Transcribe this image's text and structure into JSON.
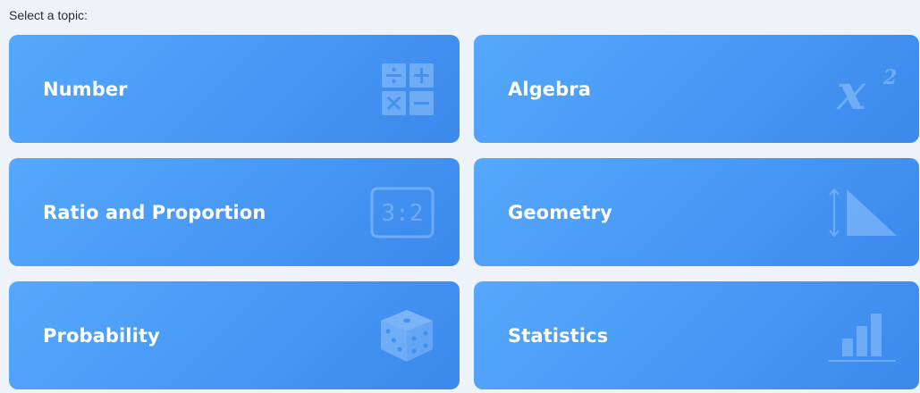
{
  "prompt": "Select a topic:",
  "topics": [
    {
      "label": "Number",
      "icon": "operations-icon"
    },
    {
      "label": "Algebra",
      "icon": "x-squared-icon"
    },
    {
      "label": "Ratio and Proportion",
      "icon": "ratio-icon"
    },
    {
      "label": "Geometry",
      "icon": "triangle-measure-icon"
    },
    {
      "label": "Probability",
      "icon": "dice-icon"
    },
    {
      "label": "Statistics",
      "icon": "bar-chart-icon"
    }
  ],
  "icon_text": {
    "ratio": "3:2",
    "algebra_base": "x",
    "algebra_exp": "2"
  },
  "colors": {
    "background": "#eef3fa",
    "card_start": "#55a8fd",
    "card_end": "#3b89ec",
    "label": "#ffffff"
  }
}
